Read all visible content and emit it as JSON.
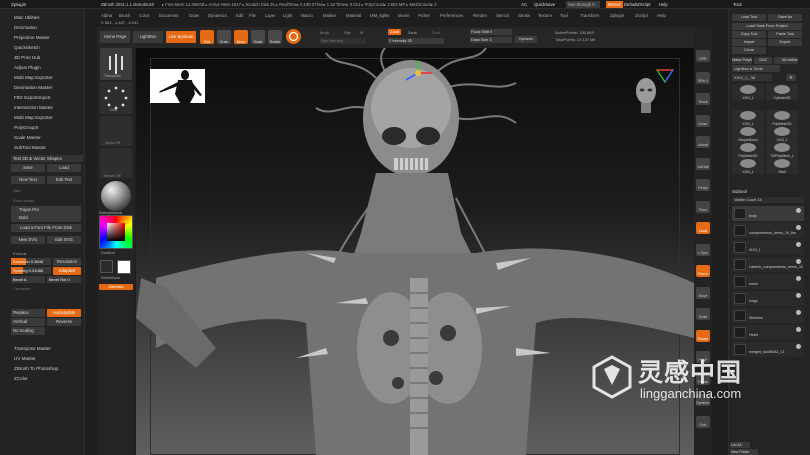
{
  "app": {
    "left_title": "Zplugin",
    "window_title": "ZBrush 2021.1.1 demobrush",
    "status_bar": "▸ Free Mem 14.466GB ▸ Active Mem 1917 ▸ Scratch Disk 26 ▸ RealTime▸ 0.139 ZTime▸ 1.18 Timer▸ 0.014 ▸ PolyCount▸ 3.502 MP ▸ MeshCount▸ 3",
    "coords": "X 863, -1.487, -0.941",
    "ac": "AC",
    "quicksave": "QuickSave",
    "seethrough": "See-through 0",
    "menus": "Menus",
    "default_script": "DefaultZScript",
    "help": "Help",
    "right_title": "Tool"
  },
  "menubar": [
    "Alpha",
    "Brush",
    "Color",
    "Document",
    "Draw",
    "Dynamics",
    "Edit",
    "File",
    "Layer",
    "Light",
    "Macro",
    "Marker",
    "Material",
    "MM_lights",
    "Movie",
    "Picker",
    "Preferences",
    "Render",
    "Stencil",
    "Stroke",
    "Texture",
    "Tool",
    "Transform",
    "Zplugin",
    "Zscript",
    "Help"
  ],
  "left_panel": {
    "items": [
      "Misc Utilities",
      "Decimation",
      "Projection Master",
      "QuickSketch",
      "3D Print Hub",
      "Adjust Plugin",
      "Multi Map Exporter",
      "Decimation Master",
      "FBX ExportImport",
      "Intersection Master",
      "Multi Map Exporter",
      "PolyGroupIt",
      "Scale Master",
      "SubTool Master"
    ],
    "text3d": "Text 3D & Vector Shapes",
    "save": "Save",
    "load": "Load",
    "new_text": "New Text",
    "edit_text": "Edit Text",
    "size": "Size",
    "font_lib": "Font Library",
    "trajan": "Trajan Pro",
    "bold": "Bold",
    "load_font": "Load a Font File From Disk",
    "new_svg": "New SVG",
    "edit_svg": "Edit SVG",
    "extrude_label": "Extrude",
    "extrusion": "Extrusion 0.3848",
    "resolution": "Resolution",
    "spacing": "Spacing 0.31086",
    "adaptive": "Adaptive",
    "bevel_a": "Bevel A",
    "bevel_rot": "Bevel Rot 0",
    "curvature": "Curvature",
    "replace": "Replace",
    "auto_update": "AutoUpdate",
    "vertical": "Vertical",
    "reverse": "Reverse",
    "no_scaling": "No Scaling",
    "bottom_items": [
      "Transpose Master",
      "UV Master",
      "ZBrush To Photoshop",
      "ZColor"
    ]
  },
  "tray": {
    "transpose": "Transpose",
    "dots": "Dots",
    "alpha": "Alpha Off",
    "texture": "Texture Off",
    "material": "StartupMaterial",
    "gradient": "Gradient",
    "switch_color": "SwitchColor",
    "alternate": "Alternate"
  },
  "top_toolbar": {
    "home": "Home Page",
    "lightbox": "LightBox",
    "live_boolean": "Live Boolean",
    "edit": "Edit",
    "draw": "Draw",
    "move": "Move",
    "scale": "Scale",
    "rotate": "Rotate",
    "mrgb": "Mrgb",
    "rgb": "Rgb",
    "m": "M",
    "zadd": "Zadd",
    "zsub": "Zsub",
    "zcut": "Zcut",
    "rgb_intensity": "Rgb Intensity",
    "z_intensity": "Z Intensity 25",
    "focal_shift": "Focal Shift 0",
    "draw_size": "Draw Size 3",
    "dynamic": "Dynamic",
    "active_points": "ActivePoints: 150,669",
    "total_points": "TotalPoints: 14.137 Mil"
  },
  "colors": {
    "accent": "#e66a14",
    "panel": "#262626",
    "button": "#3a3a3a",
    "canvas_top": "#0c0c0c",
    "canvas_bottom": "#5f5f5f"
  },
  "shelf": [
    "BPR",
    "SPix 3",
    "Scroll",
    "Zoom",
    "Actual",
    "AAHalf",
    "Persp",
    "Floor",
    "Local",
    "L.Sym",
    "Frame",
    "Move",
    "Scale",
    "Rotate",
    "PolyF",
    "Transp",
    "Dynamic",
    "Solo"
  ],
  "right_panel": {
    "buttons": [
      "Load Tool",
      "Save As",
      "Load Tools From Project",
      "Copy Tool",
      "Paste Tool",
      "Import",
      "Export",
      "Clone",
      "Make PolyMesh3D",
      "GoZ",
      "All",
      "Visible",
      "R"
    ],
    "lightbox_tools": "Lightbox ▸ Tools",
    "xix_label": "XIX3_1_ 38",
    "thumbs": [
      "XIX3_1",
      "Cylinder3D",
      "XIX3_1",
      "PolyMesh3D",
      "SimpleBrush",
      "XIX3_1",
      "PolyMesh3D",
      "TMPolyMesh_1",
      "XIX3_1",
      "Skull"
    ],
    "subtool_header": "Subtool",
    "visible_count": "Visible Count 14",
    "subtools": [
      "body",
      "cuerpoenteros_demo_10_fire",
      "XIX3_1",
      "Ushitch_cuerpoenteros_demo_10",
      "mesh",
      "lungs",
      "Skeleton",
      "Heart",
      "merged_skull0042_13"
    ],
    "list_all": "List All",
    "new_folder": "New Folder"
  },
  "watermark": {
    "chinese": "灵感中国",
    "domain": "lingganchina.com"
  }
}
